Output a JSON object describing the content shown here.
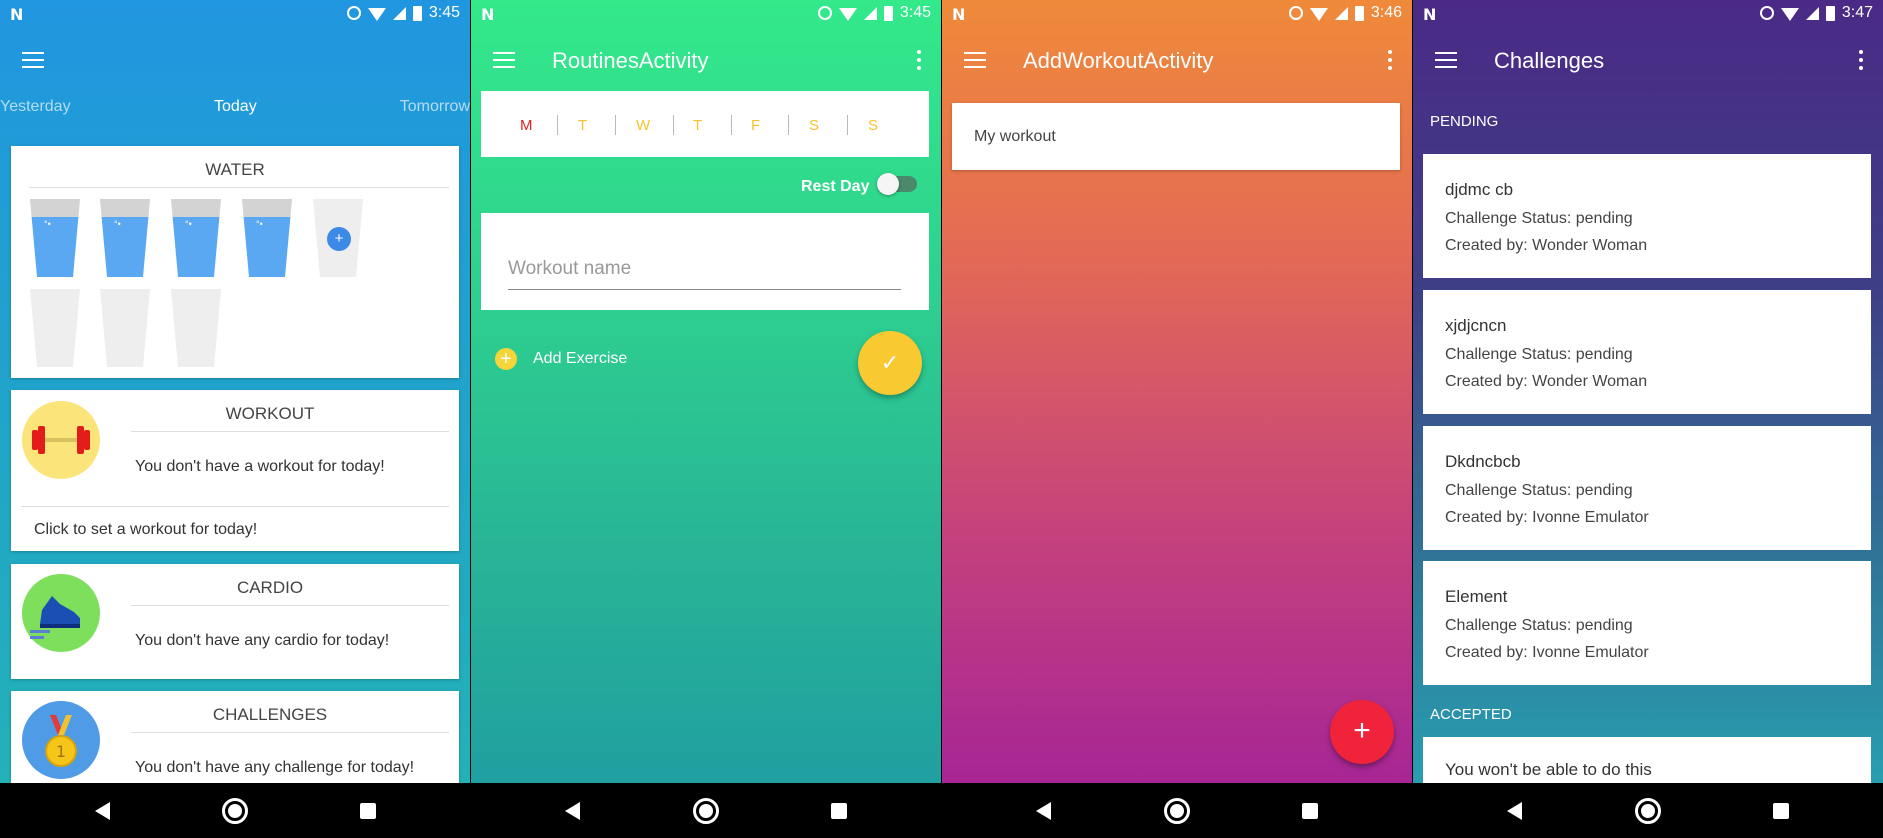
{
  "status_bars": [
    {
      "time": "3:45"
    },
    {
      "time": "3:45"
    },
    {
      "time": "3:46"
    },
    {
      "time": "3:47"
    }
  ],
  "screen1": {
    "tabs": {
      "yesterday": "Yesterday",
      "today": "Today",
      "tomorrow": "Tomorrow"
    },
    "water": {
      "title": "WATER",
      "filled_glasses": 4,
      "total_glasses": 8
    },
    "workout": {
      "title": "WORKOUT",
      "message": "You don't have a workout for today!",
      "action": "Click to set a workout for today!"
    },
    "cardio": {
      "title": "CARDIO",
      "message": "You don't have any cardio for today!"
    },
    "challenges": {
      "title": "CHALLENGES",
      "message": "You don't have any challenge for today!"
    }
  },
  "screen2": {
    "title": "RoutinesActivity",
    "days": [
      "M",
      "T",
      "W",
      "T",
      "F",
      "S",
      "S"
    ],
    "selected_day_color": "#e02020",
    "day_color": "#f4c430",
    "rest_day_label": "Rest Day",
    "workout_name_placeholder": "Workout name",
    "add_exercise_label": "Add Exercise",
    "confirm_glyph": "✓"
  },
  "screen3": {
    "title": "AddWorkoutActivity",
    "workout_item": "My workout",
    "add_glyph": "+"
  },
  "screen4": {
    "title": "Challenges",
    "pending_header": "PENDING",
    "accepted_header": "ACCEPTED",
    "pending": [
      {
        "name": "djdmc cb",
        "status": "Challenge Status: pending",
        "creator": "Created by: Wonder Woman"
      },
      {
        "name": "xjdjcncn",
        "status": "Challenge Status: pending",
        "creator": "Created by: Wonder Woman"
      },
      {
        "name": "Dkdncbcb",
        "status": "Challenge Status: pending",
        "creator": "Created by: Ivonne Emulator"
      },
      {
        "name": "Element",
        "status": "Challenge Status: pending",
        "creator": "Created by: Ivonne Emulator"
      }
    ],
    "accepted": [
      {
        "name": "You won't be able to do this"
      }
    ]
  },
  "colors": {
    "screen1_bar": "#2196e0",
    "screen2_bar": "#33e98a",
    "screen3_bar": "#ef8a3a",
    "screen4_bar": "#4a2a86",
    "fab_yellow": "#f8c930",
    "fab_red": "#f0233a"
  },
  "icons": [
    "menu-icon",
    "more-vert-icon",
    "alarm-icon",
    "wifi-icon",
    "signal-icon",
    "battery-icon",
    "dumbbell-icon",
    "sneaker-icon",
    "medal-icon",
    "check-icon",
    "plus-icon",
    "back-icon",
    "home-icon",
    "recents-icon"
  ]
}
